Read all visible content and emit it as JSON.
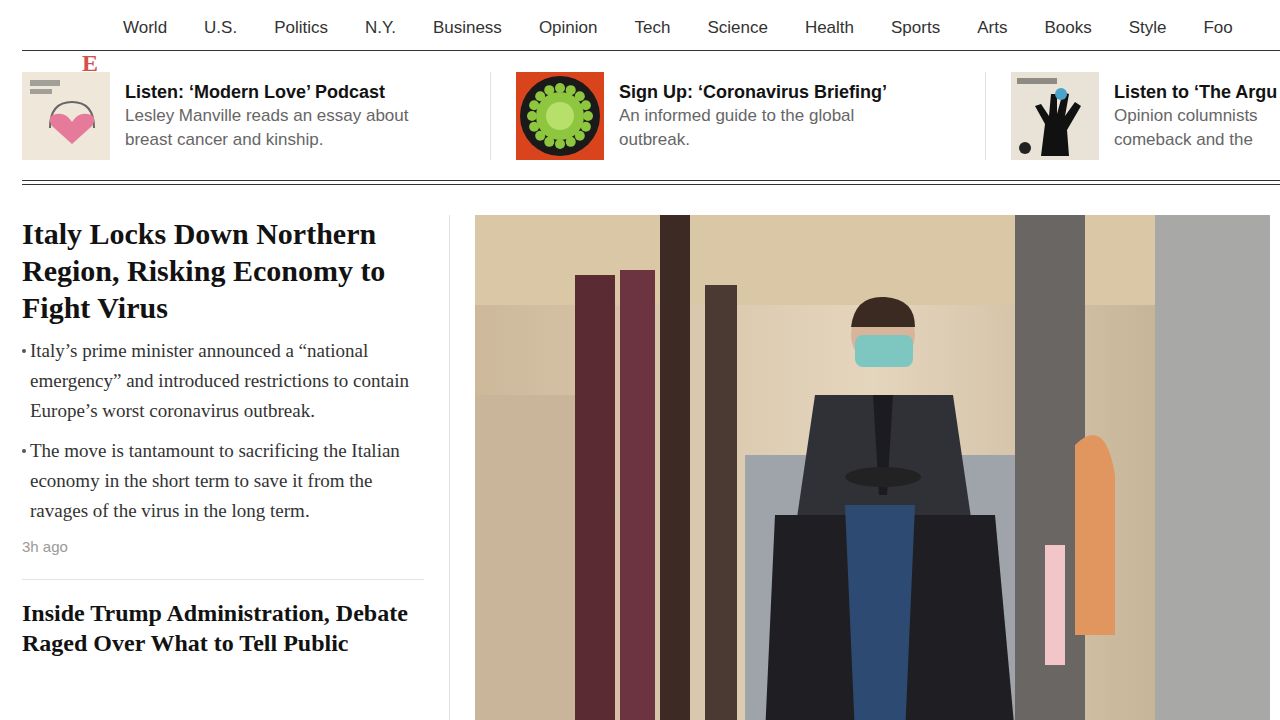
{
  "watermark": "E",
  "nav": {
    "items": [
      "World",
      "U.S.",
      "Politics",
      "N.Y.",
      "Business",
      "Opinion",
      "Tech",
      "Science",
      "Health",
      "Sports",
      "Arts",
      "Books",
      "Style",
      "Foo"
    ]
  },
  "promos": [
    {
      "kind": "modern-love",
      "title": "Listen: ‘Modern Love’ Podcast",
      "lines": [
        "Lesley Manville reads an essay about",
        "breast cancer and kinship."
      ]
    },
    {
      "kind": "coronavirus",
      "title": "Sign Up: ‘Coronavirus Briefing’",
      "lines": [
        "An informed guide to the global",
        "outbreak."
      ]
    },
    {
      "kind": "argument",
      "title": "Listen to ‘The Argu",
      "lines": [
        "Opinion columnists",
        "comeback and the"
      ]
    }
  ],
  "lead": {
    "headline": "Italy Locks Down Northern Region, Risking Economy to Fight Virus",
    "bullets": [
      "Italy’s prime minister announced a “national emergency” and introduced restrictions to contain Europe’s worst coronavirus outbreak.",
      "The move is tantamount to sacrificing the Italian economy in the short term to save it from the ravages of the virus in the long term."
    ],
    "timestamp": "3h ago"
  },
  "next": {
    "headline": "Inside Trump Administration, Debate Raged Over What to Tell Public"
  }
}
